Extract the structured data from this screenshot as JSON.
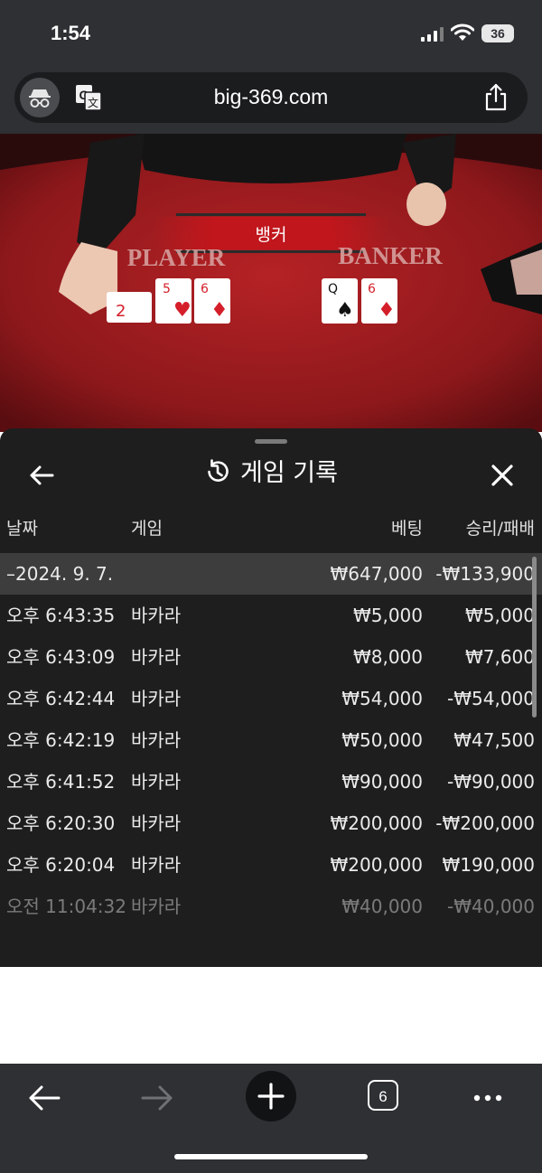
{
  "status_bar": {
    "time": "1:54",
    "battery": "36"
  },
  "browser": {
    "url": "big-369.com",
    "tab_count": "6"
  },
  "game": {
    "result_banner": "뱅커",
    "player_label": "PLAYER",
    "banker_label": "BANKER"
  },
  "history": {
    "title": "게임 기록",
    "columns": {
      "date": "날짜",
      "game": "게임",
      "bet": "베팅",
      "win_loss": "승리/패배"
    },
    "summary": {
      "date": "–2024. 9. 7.",
      "bet": "₩647,000",
      "win_loss": "-₩133,900"
    },
    "rows": [
      {
        "time": "오후 6:43:35",
        "game": "바카라",
        "bet": "₩5,000",
        "win_loss": "₩5,000"
      },
      {
        "time": "오후 6:43:09",
        "game": "바카라",
        "bet": "₩8,000",
        "win_loss": "₩7,600"
      },
      {
        "time": "오후 6:42:44",
        "game": "바카라",
        "bet": "₩54,000",
        "win_loss": "-₩54,000"
      },
      {
        "time": "오후 6:42:19",
        "game": "바카라",
        "bet": "₩50,000",
        "win_loss": "₩47,500"
      },
      {
        "time": "오후 6:41:52",
        "game": "바카라",
        "bet": "₩90,000",
        "win_loss": "-₩90,000"
      },
      {
        "time": "오후 6:20:30",
        "game": "바카라",
        "bet": "₩200,000",
        "win_loss": "-₩200,000"
      },
      {
        "time": "오후 6:20:04",
        "game": "바카라",
        "bet": "₩200,000",
        "win_loss": "₩190,000"
      },
      {
        "time": "오전 11:04:32",
        "game": "바카라",
        "bet": "₩40,000",
        "win_loss": "-₩40,000"
      }
    ]
  },
  "icons": {
    "incognito": "incognito-icon",
    "translate": "translate-icon",
    "share": "share-icon",
    "back": "arrow-left-icon",
    "forward": "arrow-right-icon",
    "new_tab": "plus-icon",
    "tabs": "tabs-icon",
    "more": "more-icon",
    "history": "history-icon",
    "close": "close-icon"
  },
  "colors": {
    "chrome_bg": "#2e3033",
    "panel_bg": "#1e1e1e",
    "summary_row": "#3d3d3d",
    "felt_red": "#9a1c1f",
    "banner_red": "#c0161c"
  }
}
